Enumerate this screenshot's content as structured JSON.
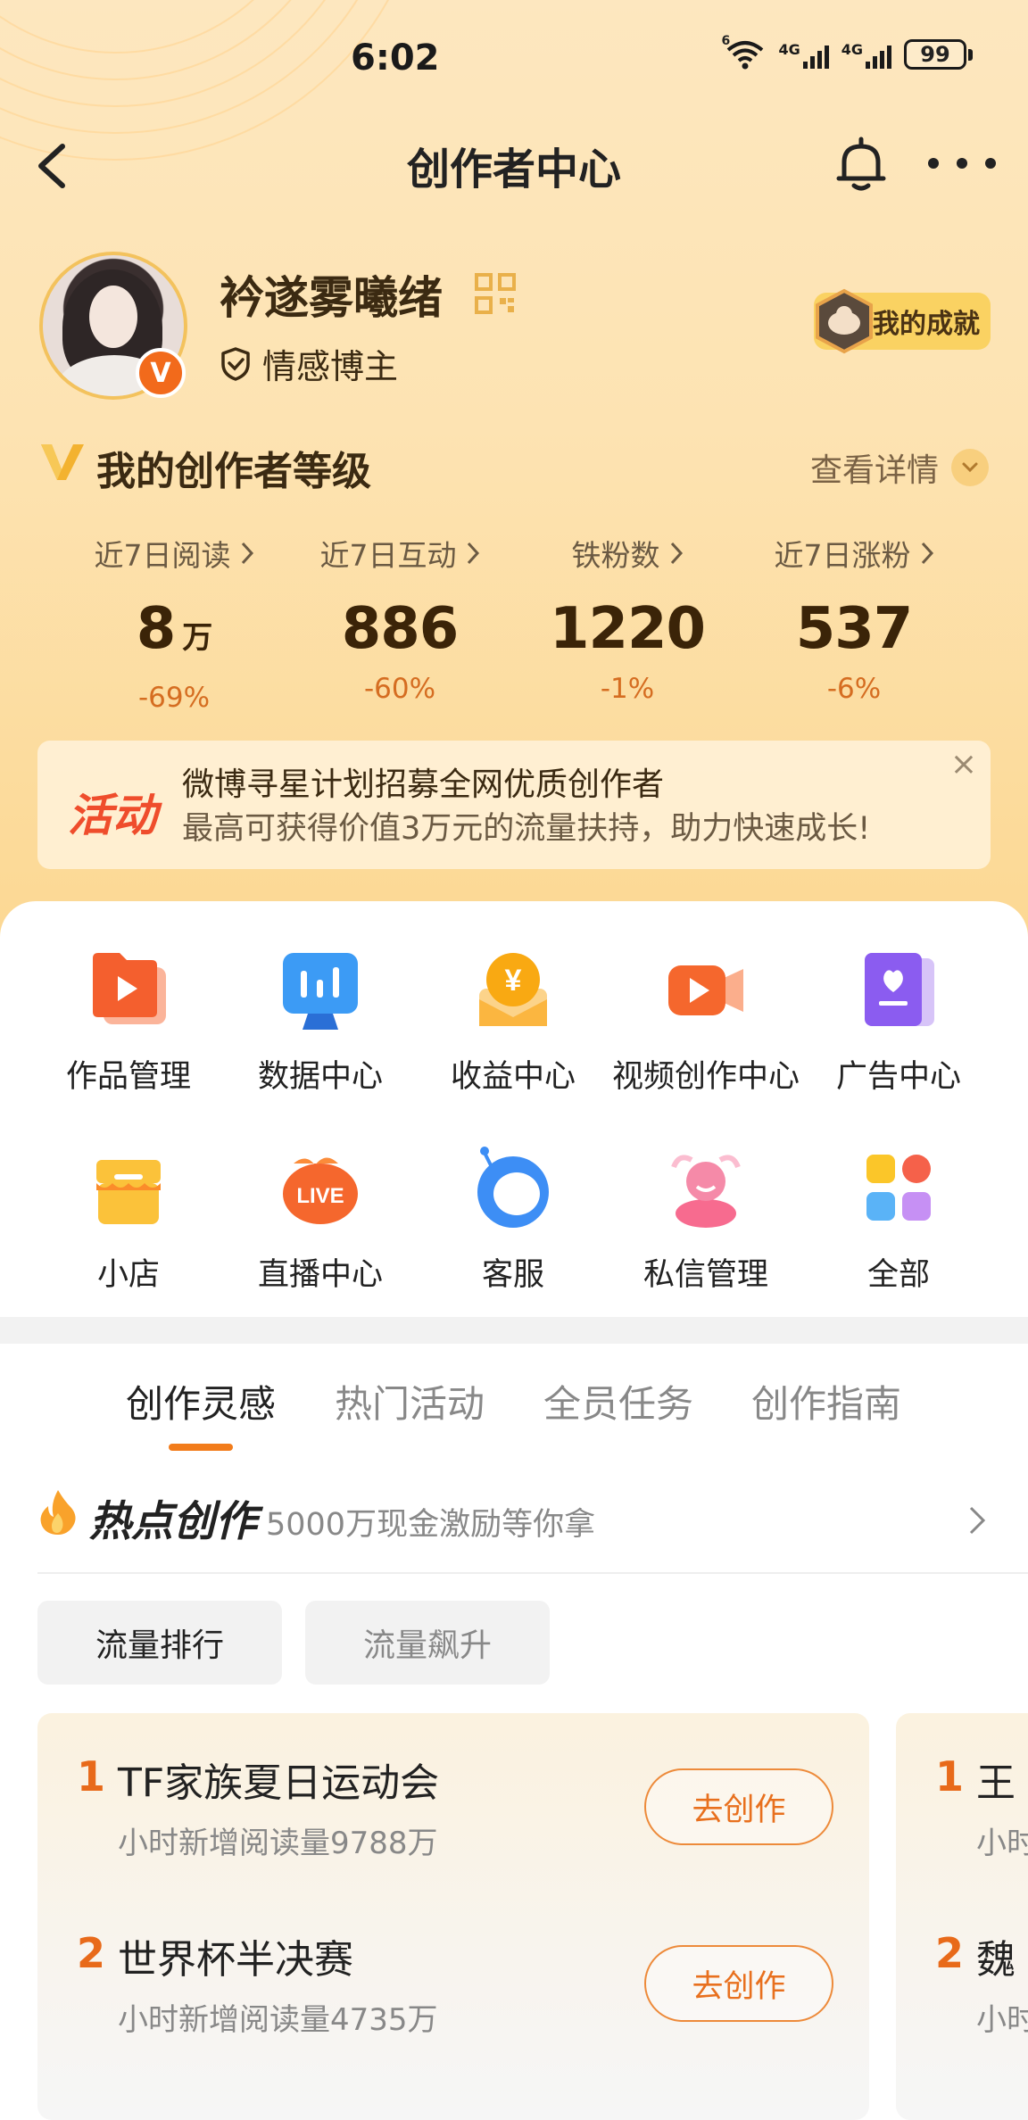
{
  "status_bar": {
    "time": "6:02",
    "signal_1": "4G",
    "signal_2": "4G",
    "wifi_label": "6",
    "battery": "99"
  },
  "nav": {
    "title": "创作者中心"
  },
  "profile": {
    "username": "衿遂雾曦绪",
    "role": "情感博主",
    "verified_badge": "V",
    "achievement_label": "我的成就"
  },
  "level": {
    "title": "我的创作者等级",
    "detail_label": "查看详情"
  },
  "stats": [
    {
      "label": "近7日阅读",
      "value": "8",
      "unit": "万",
      "change": "-69%"
    },
    {
      "label": "近7日互动",
      "value": "886",
      "unit": "",
      "change": "-60%"
    },
    {
      "label": "铁粉数",
      "value": "1220",
      "unit": "",
      "change": "-1%"
    },
    {
      "label": "近7日涨粉",
      "value": "537",
      "unit": "",
      "change": "-6%"
    }
  ],
  "banner": {
    "tag": "活动",
    "title": "微博寻星计划招募全网优质创作者",
    "subtitle": "最高可获得价值3万元的流量扶持，助力快速成长!",
    "close": "×"
  },
  "tools": [
    {
      "label": "作品管理",
      "icon": "works-icon"
    },
    {
      "label": "数据中心",
      "icon": "data-center-icon"
    },
    {
      "label": "收益中心",
      "icon": "income-icon"
    },
    {
      "label": "视频创作中心",
      "icon": "video-icon"
    },
    {
      "label": "广告中心",
      "icon": "ad-icon"
    },
    {
      "label": "小店",
      "icon": "shop-icon"
    },
    {
      "label": "直播中心",
      "icon": "live-icon"
    },
    {
      "label": "客服",
      "icon": "service-icon"
    },
    {
      "label": "私信管理",
      "icon": "message-icon"
    },
    {
      "label": "全部",
      "icon": "all-icon"
    }
  ],
  "live_badge": "LIVE",
  "income_symbol": "¥",
  "tabs": [
    {
      "label": "创作灵感",
      "active": true
    },
    {
      "label": "热门活动",
      "active": false
    },
    {
      "label": "全员任务",
      "active": false
    },
    {
      "label": "创作指南",
      "active": false
    }
  ],
  "hot": {
    "title": "热点创作",
    "subtitle": "5000万现金激励等你拿"
  },
  "filters": [
    {
      "label": "流量排行",
      "active": true
    },
    {
      "label": "流量飙升",
      "active": false
    }
  ],
  "ranking": {
    "button_label": "去创作",
    "items": [
      {
        "rank": "1",
        "title": "TF家族夏日运动会",
        "meta": "小时新增阅读量9788万"
      },
      {
        "rank": "2",
        "title": "世界杯半决赛",
        "meta": "小时新增阅读量4735万"
      }
    ],
    "side_items": [
      {
        "rank": "1",
        "title": "王",
        "meta": "小时"
      },
      {
        "rank": "2",
        "title": "魏",
        "meta": "小时"
      }
    ]
  },
  "colors": {
    "accent": "#f27c1b",
    "header_bg": "#fde3b2",
    "change_text": "#d56d21"
  }
}
